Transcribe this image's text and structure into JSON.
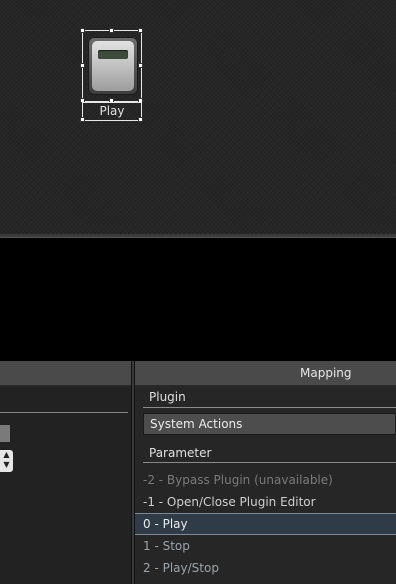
{
  "widget": {
    "label": "Play"
  },
  "mapping_panel": {
    "header": "Mapping",
    "plugin_label": "Plugin",
    "plugin_value": "System Actions",
    "parameter_label": "Parameter",
    "parameters": [
      {
        "text": "-2 - Bypass Plugin (unavailable)",
        "state": "disabled"
      },
      {
        "text": "-1 - Open/Close Plugin Editor",
        "state": "normal"
      },
      {
        "text": "0 - Play",
        "state": "selected"
      },
      {
        "text": "1 - Stop",
        "state": "normal"
      },
      {
        "text": "2 - Play/Stop",
        "state": "normal"
      }
    ]
  },
  "left_panel": {
    "spinner_icon": "up-down-arrows-icon"
  }
}
